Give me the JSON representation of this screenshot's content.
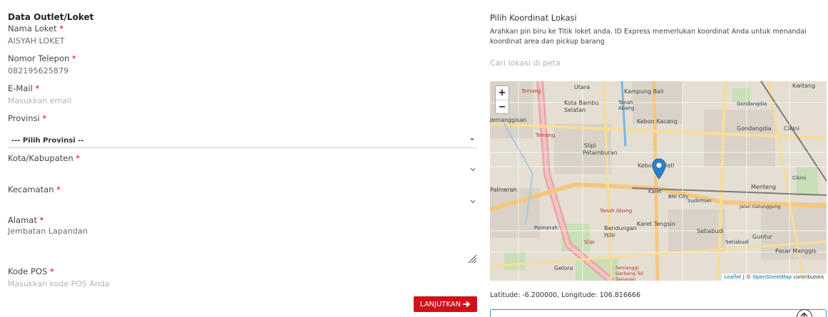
{
  "form": {
    "section_title": "Data Outlet/Loket",
    "required_mark": "*",
    "nama_loket": {
      "label": "Nama Loket",
      "value": "AISYAH LOKET"
    },
    "telepon": {
      "label": "Nomor Telepon",
      "value": "082195625879"
    },
    "email": {
      "label": "E-Mail",
      "placeholder": "Masukkan email"
    },
    "provinsi": {
      "label": "Provinsi",
      "selected": "--- Pilih Provinsi --"
    },
    "kota": {
      "label": "Kota/Kabupaten"
    },
    "kecamatan": {
      "label": "Kecamatan"
    },
    "alamat": {
      "label": "Alamat",
      "value": "Jembatan Lapandan"
    },
    "kode_pos": {
      "label": "Kode POS",
      "placeholder": "Masukkan kode POS Anda"
    },
    "submit_label": "LANJUTKAN"
  },
  "location": {
    "title": "Pilih Koordinat Lokasi",
    "description": "Arahkan pin biru ke Titik loket anda. ID Express memerlukan koordinat Anda untuk menandai koordinat area dan pickup barang",
    "search_placeholder": "Cari lokasi di peta",
    "coordinates_text": "Latitude: -6.200000, Longitude: 106.816666"
  },
  "map": {
    "zoom_in": "+",
    "zoom_out": "−",
    "attribution_leaflet": "Leaflet",
    "attribution_sep": " | © ",
    "attribution_osm": "OpenStreetMap",
    "attribution_tail": " contributors",
    "place_labels": [
      "Utara",
      "Kampung Bali",
      "Kwitang",
      "Tomang",
      "Kota Bambu Selatan",
      "Tanah Abang",
      "Gondangdia",
      "Jemanggisan",
      "Kebon Kacang",
      "Gondangdia",
      "Cikini",
      "Tomang",
      "Slipi",
      "Petamburan",
      "Kebon Melati",
      "Cikini",
      "Palmerah",
      "Karet",
      "BNI City",
      "Menteng",
      "Sudirman",
      "Jalan Galunggung",
      "Tanah Abang",
      "Palmerah",
      "Bendungan Hilir",
      "Karet Tengsin",
      "Setiabudi",
      "Guntur",
      "Slipi",
      "Setiabudi",
      "Pasar Manggis",
      "Gelora",
      "Semanggi Gerbang Tol Senayan"
    ]
  }
}
